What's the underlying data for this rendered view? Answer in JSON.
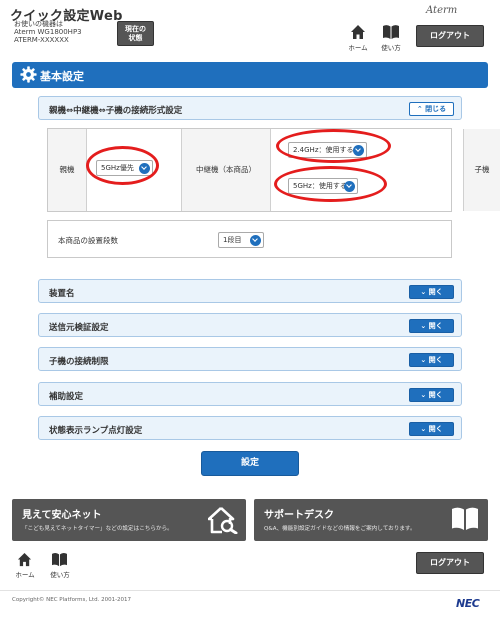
{
  "header": {
    "app_title": "クイック設定Web",
    "device_label": "お使いの機器は",
    "device_model": "Aterm WG1800HP3",
    "device_name": "ATERM-XXXXXX",
    "status_button_line1": "現在の",
    "status_button_line2": "状態",
    "brand": "Aterm",
    "nav": {
      "home": "ホーム",
      "manual": "使い方"
    },
    "logout": "ログアウト"
  },
  "section": {
    "title": "基本設定"
  },
  "connection": {
    "title": "親機⇔中継機⇔子機の接続形式設定",
    "close_label": "閉じる",
    "parent_label": "親機",
    "parent_value": "5GHz優先",
    "relay_label": "中継機（本商品）",
    "relay_24_value": "2.4GHz：使用する",
    "relay_5_value": "5GHz：使用する",
    "child_label": "子機",
    "steps_label": "本商品の設置段数",
    "steps_value": "1段目"
  },
  "panels": [
    {
      "title": "装置名",
      "open_label": "開く"
    },
    {
      "title": "送信元検証設定",
      "open_label": "開く"
    },
    {
      "title": "子機の接続制限",
      "open_label": "開く"
    },
    {
      "title": "補助設定",
      "open_label": "開く"
    },
    {
      "title": "状態表示ランプ点灯設定",
      "open_label": "開く"
    }
  ],
  "submit": "設定",
  "banners": {
    "left_title": "見えて安心ネット",
    "left_desc": "「こども見えてネットタイマー」などの設定はこちらから。",
    "right_title": "サポートデスク",
    "right_desc": "Q&A、機能別設定ガイドなどの情報をご案内しております。"
  },
  "footer": {
    "nav": {
      "home": "ホーム",
      "manual": "使い方"
    },
    "logout": "ログアウト",
    "copyright": "Copyright© NEC Platforms, Ltd. 2001-2017",
    "logo": "NEC"
  },
  "colors": {
    "accent": "#1f6fbd",
    "panel_bg": "#eaf3fb",
    "dark_button": "#555555",
    "highlight": "#e41d1d"
  }
}
